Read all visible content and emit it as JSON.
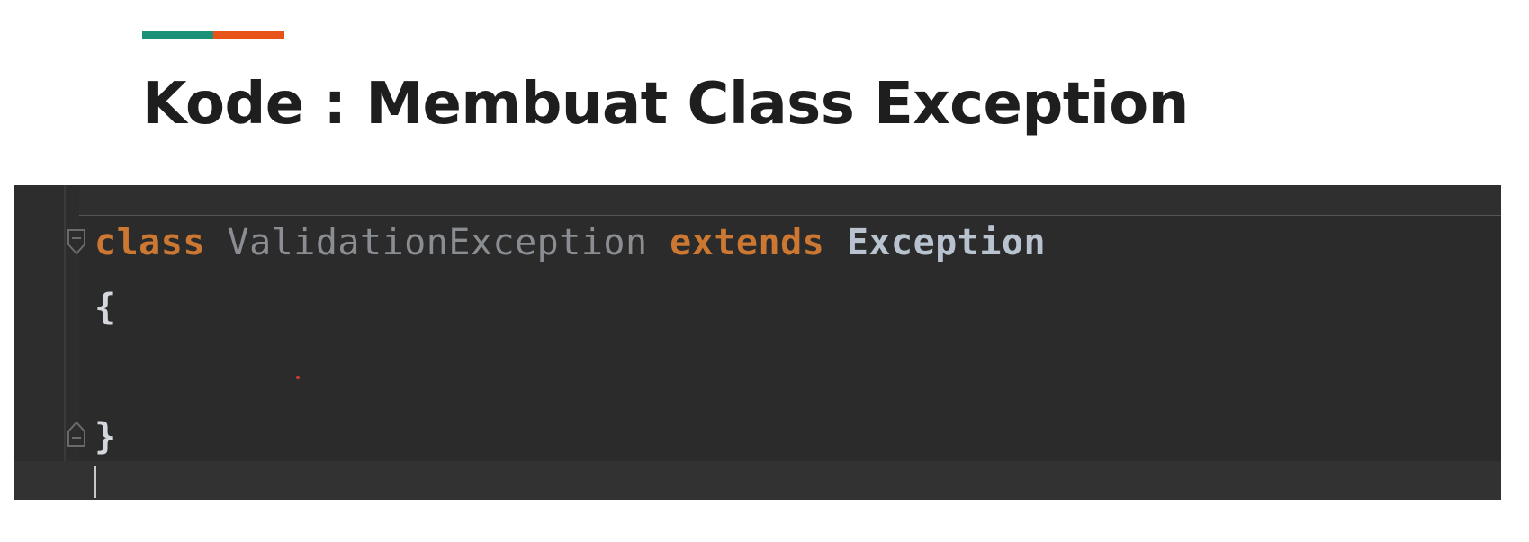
{
  "slide": {
    "title": "Kode : Membuat Class Exception",
    "accent_colors": [
      "#1a9178",
      "#e8531a"
    ]
  },
  "editor": {
    "background": "#2b2b2b",
    "lines": [
      {
        "tokens": [
          {
            "text": "class",
            "role": "keyword"
          },
          {
            "text": " ",
            "role": "space"
          },
          {
            "text": "ValidationException",
            "role": "class-name-unused"
          },
          {
            "text": " ",
            "role": "space"
          },
          {
            "text": "extends",
            "role": "keyword"
          },
          {
            "text": " ",
            "role": "space"
          },
          {
            "text": "Exception",
            "role": "class-name"
          }
        ]
      },
      {
        "tokens": [
          {
            "text": "{",
            "role": "brace"
          }
        ]
      },
      {
        "tokens": []
      },
      {
        "tokens": [
          {
            "text": "}",
            "role": "brace"
          }
        ]
      }
    ],
    "gutter_icons": [
      "fold-collapse-icon",
      "fold-end-icon"
    ],
    "colors": {
      "keyword": "#cc7832",
      "class_name_unused": "#8a8d91",
      "class_name": "#b8c3cf",
      "brace": "#d4d8dc"
    }
  }
}
